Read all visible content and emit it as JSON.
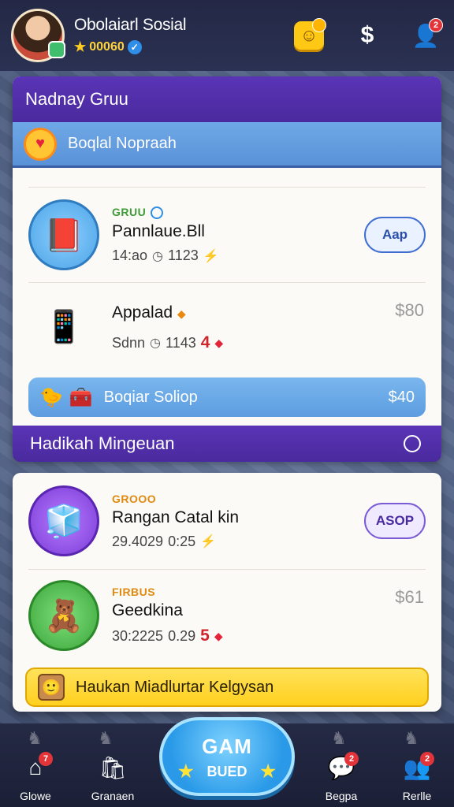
{
  "header": {
    "profile_name": "Obolaiarl Sosial",
    "profile_coins": "00060",
    "smile_badge": "",
    "user_badge": "2"
  },
  "panel_1": {
    "group_title": "Nadnay Gruu",
    "sub_title": "Boqlal Nopraah",
    "items": [
      {
        "tag": "GRUU",
        "title": "Pannlaue.Bll",
        "meta_time": "14:ao",
        "meta_count": "1123",
        "button": "Aap"
      },
      {
        "tag": "",
        "title": "Appalad",
        "meta_time": "Sdnn",
        "meta_count": "1143",
        "red_value": "4",
        "price": "$80"
      }
    ],
    "promo": {
      "label": "Boqiar Soliop",
      "price": "$40"
    }
  },
  "section_2": {
    "title": "Hadikah Mingeuan"
  },
  "panel_2": {
    "items": [
      {
        "tag": "GROOO",
        "title": "Rangan Catal kin",
        "meta_time": "29.4029",
        "meta_count": "0:25",
        "button": "ASOP"
      },
      {
        "tag": "FIRBUS",
        "title": "Geedkina",
        "meta_time": "30:2225",
        "meta_count": "0.29",
        "red_value": "5",
        "price": "$61"
      }
    ],
    "promo": {
      "label": "Haukan Miadlurtar Kelgysan"
    }
  },
  "bottom_nav": {
    "items": [
      {
        "label": "Glowe",
        "icon": "home-icon",
        "badge": "7"
      },
      {
        "label": "Granaen",
        "icon": "bag-icon",
        "badge": ""
      },
      {
        "label": "Begpa",
        "icon": "chat-icon",
        "badge": "2"
      },
      {
        "label": "Rerlle",
        "icon": "people-icon",
        "badge": "2"
      }
    ],
    "game_button": {
      "top": "GAM",
      "bottom": "BUED"
    }
  },
  "colors": {
    "brand_purple": "#4a2a9e",
    "accent_blue": "#5c9de0",
    "promo_yellow": "#ffd01e",
    "badge_red": "#e3343a"
  }
}
